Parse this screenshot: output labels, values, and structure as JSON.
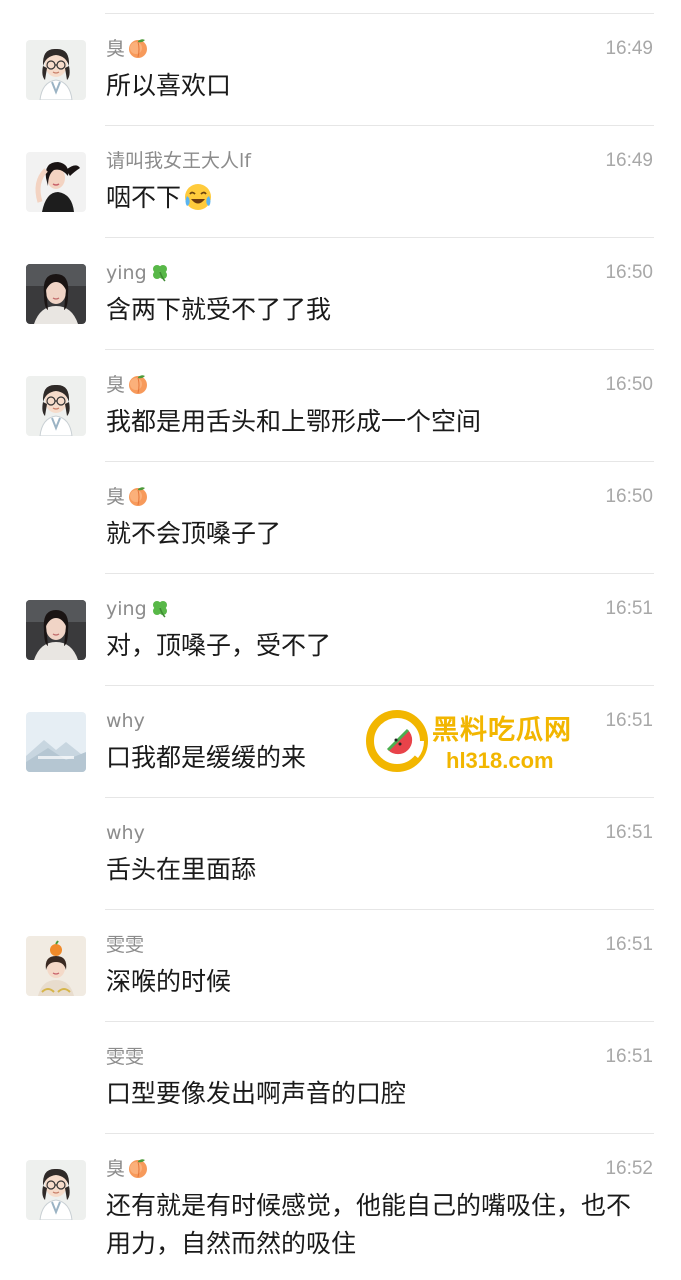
{
  "messages": [
    {
      "sender": "臭",
      "emoji": "peach-icon",
      "time": "16:49",
      "text": "所以喜欢口",
      "avatar": "glasses-girl-avatar"
    },
    {
      "sender": "请叫我女王大人lf",
      "emoji": "",
      "time": "16:49",
      "text": "咽不下",
      "trailing_emoji": "crying-laughing-icon",
      "avatar": "woman-photo-avatar"
    },
    {
      "sender": "ying",
      "emoji": "clover-icon",
      "time": "16:50",
      "text": "含两下就受不了了我",
      "avatar": "girl-car-avatar"
    },
    {
      "sender": "臭",
      "emoji": "peach-icon",
      "time": "16:50",
      "text": "我都是用舌头和上鄂形成一个空间",
      "avatar": "glasses-girl-avatar"
    },
    {
      "sender": "臭",
      "emoji": "peach-icon",
      "time": "16:50",
      "text": "就不会顶嗓子了",
      "avatar": ""
    },
    {
      "sender": "ying",
      "emoji": "clover-icon",
      "time": "16:51",
      "text": "对，顶嗓子，受不了",
      "avatar": "girl-car-avatar"
    },
    {
      "sender": "why",
      "emoji": "",
      "time": "16:51",
      "text": "口我都是缓缓的来",
      "avatar": "placeholder-landscape-avatar"
    },
    {
      "sender": "why",
      "emoji": "",
      "time": "16:51",
      "text": "舌头在里面舔",
      "avatar": ""
    },
    {
      "sender": "雯雯",
      "emoji": "",
      "time": "16:51",
      "text": "深喉的时候",
      "avatar": "girl-orange-avatar"
    },
    {
      "sender": "雯雯",
      "emoji": "",
      "time": "16:51",
      "text": "口型要像发出啊声音的口腔",
      "avatar": ""
    },
    {
      "sender": "臭",
      "emoji": "peach-icon",
      "time": "16:52",
      "text": "还有就是有时候感觉，他能自己的嘴吸住，也不用力，自然而然的吸住",
      "avatar": "glasses-girl-avatar"
    }
  ],
  "watermark": {
    "title": "黑料吃瓜网",
    "url": "hl318.com"
  },
  "colors": {
    "sender": "#8c8c8c",
    "time": "#a8a8a8",
    "text": "#1a1a1a",
    "divider": "#e6e6e6",
    "watermark": "#f2b600"
  }
}
